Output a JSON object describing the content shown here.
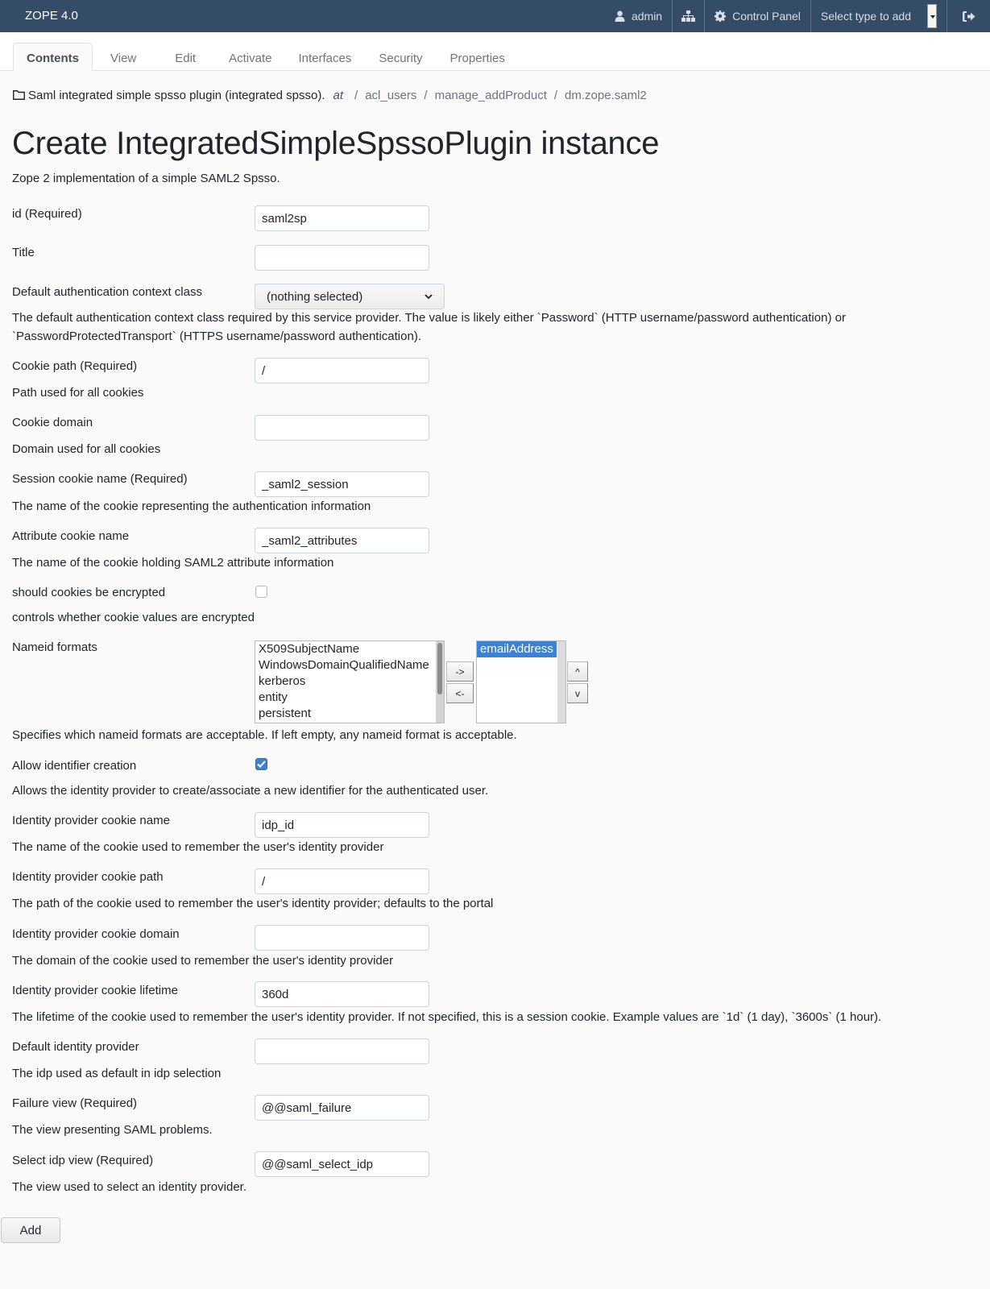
{
  "navbar": {
    "brand": "ZOPE 4.0",
    "user_label": "admin",
    "user_icon": "user-icon",
    "sitemap_icon": "sitemap-icon",
    "control_panel_label": "Control Panel",
    "control_panel_icon": "gear-icon",
    "add_select_placeholder": "Select type to add",
    "logout_icon": "sign-out-icon"
  },
  "tabs": [
    {
      "label": "Contents",
      "active": true
    },
    {
      "label": "View",
      "active": false
    },
    {
      "label": "Edit",
      "active": false
    },
    {
      "label": "Activate",
      "active": false
    },
    {
      "label": "Interfaces",
      "active": false
    },
    {
      "label": "Security",
      "active": false
    },
    {
      "label": "Properties",
      "active": false
    }
  ],
  "breadcrumb": {
    "icon": "folder-icon",
    "title": "Saml integrated simple spsso plugin (integrated spsso).",
    "at": "at",
    "root_sep": "/",
    "items": [
      "acl_users",
      "manage_addProduct",
      "dm.zope.saml2"
    ],
    "sep": "/"
  },
  "page": {
    "title": "Create IntegratedSimpleSpssoPlugin instance",
    "subtitle": "Zope 2 implementation of a simple SAML2 Spsso."
  },
  "form": {
    "id": {
      "label": "id (Required)",
      "value": "saml2sp"
    },
    "title": {
      "label": "Title",
      "value": ""
    },
    "auth_context": {
      "label": "Default authentication context class",
      "selected": "(nothing selected)",
      "help_line1": "The default authentication context class required by this service provider. The value is likely either `Password` (HTTP username/password authentication) or",
      "help_line2": "`PasswordProtectedTransport` (HTTPS username/password authentication)."
    },
    "cookie_path": {
      "label": "Cookie path (Required)",
      "value": "/",
      "help": "Path used for all cookies"
    },
    "cookie_domain": {
      "label": "Cookie domain",
      "value": "",
      "help": "Domain used for all cookies"
    },
    "session_cookie": {
      "label": "Session cookie name (Required)",
      "value": "_saml2_session",
      "help": "The name of the cookie representing the authentication information"
    },
    "attribute_cookie": {
      "label": "Attribute cookie name",
      "value": "_saml2_attributes",
      "help": "The name of the cookie holding SAML2 attribute information"
    },
    "encrypt": {
      "label": "should cookies be encrypted",
      "checked": false,
      "help": "controls whether cookie values are encrypted"
    },
    "nameid": {
      "label": "Nameid formats",
      "available": [
        "X509SubjectName",
        "WindowsDomainQualifiedName",
        "kerberos",
        "entity",
        "persistent"
      ],
      "selected": [
        "emailAddress"
      ],
      "add_label": "->",
      "remove_label": "<-",
      "up_label": "^",
      "down_label": "v",
      "help": "Specifies which nameid formats are acceptable. If left empty, any nameid format is acceptable."
    },
    "allow_create": {
      "label": "Allow identifier creation",
      "checked": true,
      "help": "Allows the identity provider to create/associate a new identifier for the authenticated user."
    },
    "idp_cookie_name": {
      "label": "Identity provider cookie name",
      "value": "idp_id",
      "help": "The name of the cookie used to remember the user's identity provider"
    },
    "idp_cookie_path": {
      "label": "Identity provider cookie path",
      "value": "/",
      "help": "The path of the cookie used to remember the user's identity provider; defaults to the portal"
    },
    "idp_cookie_domain": {
      "label": "Identity provider cookie domain",
      "value": "",
      "help": "The domain of the cookie used to remember the user's identity provider"
    },
    "idp_cookie_lifetime": {
      "label": "Identity provider cookie lifetime",
      "value": "360d",
      "help": "The lifetime of the cookie used to remember the user's identity provider. If not specified, this is a session cookie. Example values are `1d` (1 day), `3600s` (1 hour)."
    },
    "default_idp": {
      "label": "Default identity provider",
      "value": "",
      "help": "The idp used as default in idp selection"
    },
    "failure_view": {
      "label": "Failure view (Required)",
      "value": "@@saml_failure",
      "help": "The view presenting SAML problems."
    },
    "select_idp_view": {
      "label": "Select idp view (Required)",
      "value": "@@saml_select_idp",
      "help": "The view used to select an identity provider."
    },
    "submit_label": "Add"
  }
}
